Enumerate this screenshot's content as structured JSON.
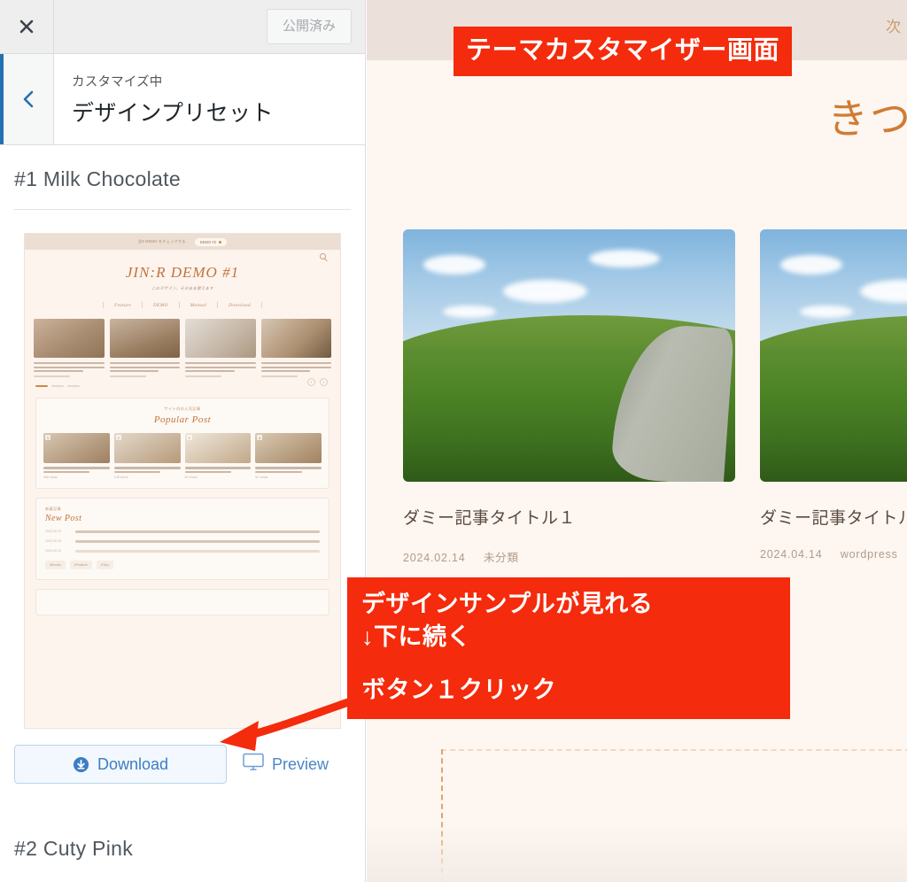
{
  "customizer": {
    "close_icon": "close-icon",
    "published_button": "公開済み",
    "back_icon": "chevron-left-icon",
    "eyebrow": "カスタマイズ中",
    "title": "デザインプリセット",
    "presets": [
      {
        "name": "#1 Milk Chocolate"
      },
      {
        "name": "#2 Cuty Pink"
      }
    ],
    "download_button": "Download",
    "download_icon": "download-circle-icon",
    "preview_button": "Preview",
    "preview_icon": "monitor-icon"
  },
  "thumbnail": {
    "topbar_text": "全8 DEMO をチェックする",
    "topbar_pill": "DEMO #2",
    "logo": "JIN:R DEMO #1",
    "tagline": "このデザイン、そのまま使えます",
    "nav": [
      "Feature",
      "DEMO",
      "Manual",
      "Download"
    ],
    "popular": {
      "eyebrow": "サイト内の人気記事",
      "heading": "Popular Post",
      "items": [
        {
          "views": "398 views"
        },
        {
          "views": "148 views"
        },
        {
          "views": "80 views"
        },
        {
          "views": "52 views"
        }
      ]
    },
    "newpost": {
      "eyebrow": "新着記事",
      "heading": "New Post",
      "rows": [
        {
          "date": "2023.06.30"
        },
        {
          "date": "2023.06.30"
        },
        {
          "date": "2023.06.30"
        }
      ],
      "tags": [
        "#Books",
        "#Feature",
        "#Tips"
      ]
    }
  },
  "preview": {
    "next_link": "次",
    "site_heading": "きつ",
    "cards": [
      {
        "title": "ダミー記事タイトル１",
        "date": "2024.02.14",
        "category": "未分類"
      },
      {
        "title": "ダミー記事タイトル",
        "date": "2024.04.14",
        "category": "wordpress"
      }
    ]
  },
  "annotations": {
    "top_banner": "テーマカスタマイザー画面",
    "mid_line1": "デザインサンプルが見れる",
    "mid_line2": "↓下に続く",
    "mid_line3": "ボタン１クリック"
  },
  "colors": {
    "annotation_red": "#f42b0c",
    "accent_blue": "#2271b1",
    "link_blue": "#3c7ec4",
    "theme_orange": "#cf7c33",
    "preview_bg": "#fdf6f1",
    "preview_band": "#ece0da"
  }
}
